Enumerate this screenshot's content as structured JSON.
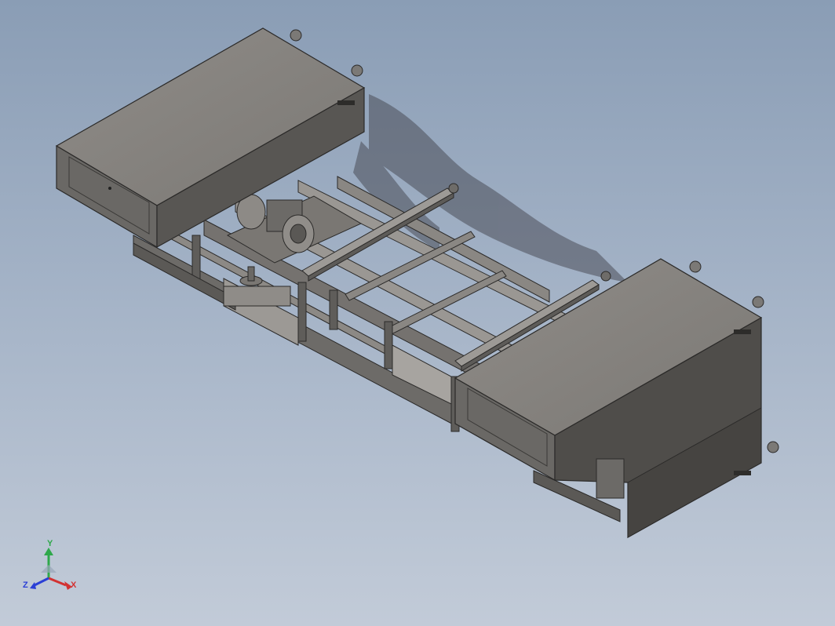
{
  "viewport": {
    "background_top": "#8a9db5",
    "background_bottom": "#c2cbd8",
    "model": "conveyor-assembly"
  },
  "triad": {
    "y_label": "Y",
    "x_label": "X",
    "z_label": "Z",
    "y_color": "#2ea84a",
    "x_color": "#d23232",
    "z_color": "#2a3fd6"
  }
}
